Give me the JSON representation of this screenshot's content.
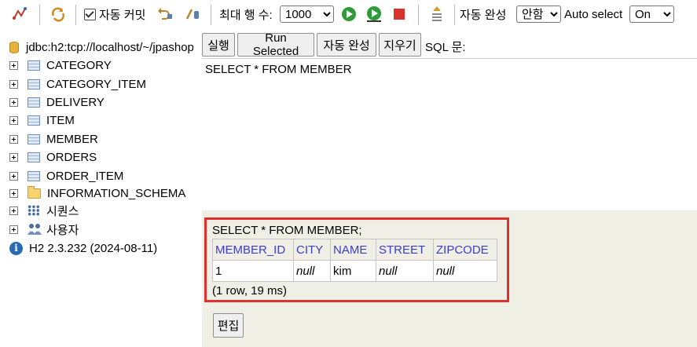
{
  "toolbar": {
    "auto_commit_label": "자동 커밋",
    "max_rows_label": "최대 행 수:",
    "max_rows_value": "1000",
    "auto_complete_label": "자동 완성",
    "auto_complete_value": "안함",
    "auto_select_label": "Auto select",
    "auto_select_value": "On"
  },
  "tree": {
    "connection": "jdbc:h2:tcp://localhost/~/jpashop",
    "tables": [
      "CATEGORY",
      "CATEGORY_ITEM",
      "DELIVERY",
      "ITEM",
      "MEMBER",
      "ORDERS",
      "ORDER_ITEM"
    ],
    "schema": "INFORMATION_SCHEMA",
    "sequences": "시퀀스",
    "users": "사용자",
    "version": "H2 2.3.232 (2024-08-11)"
  },
  "sqlbar": {
    "run_label": "실행",
    "run_selected_label": "Run Selected",
    "auto_complete_label": "자동 완성",
    "clear_label": "지우기",
    "sql_label": "SQL 문:"
  },
  "editor": {
    "query": "SELECT * FROM MEMBER"
  },
  "result": {
    "statement": "SELECT * FROM MEMBER;",
    "columns": [
      "MEMBER_ID",
      "CITY",
      "NAME",
      "STREET",
      "ZIPCODE"
    ],
    "rows": [
      [
        "1",
        "null",
        "kim",
        "null",
        "null"
      ]
    ],
    "summary": "(1 row, 19 ms)",
    "edit_label": "편집"
  }
}
